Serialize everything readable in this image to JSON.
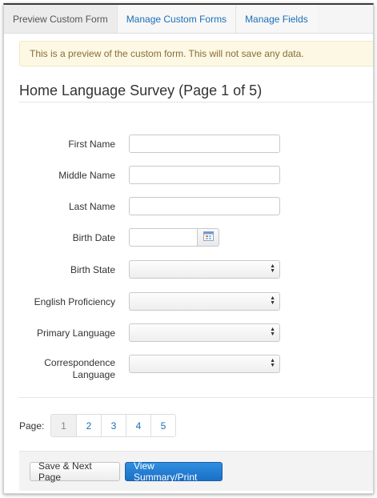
{
  "tabs": [
    {
      "label": "Preview Custom Form",
      "active": true
    },
    {
      "label": "Manage Custom Forms",
      "active": false
    },
    {
      "label": "Manage Fields",
      "active": false
    }
  ],
  "alert": {
    "text": "This is a preview of the custom form. This will not save any data."
  },
  "form": {
    "title": "Home Language Survey (Page 1 of 5)",
    "fields": {
      "first_name": {
        "label": "First Name",
        "value": ""
      },
      "middle_name": {
        "label": "Middle Name",
        "value": ""
      },
      "last_name": {
        "label": "Last Name",
        "value": ""
      },
      "birth_date": {
        "label": "Birth Date",
        "value": "",
        "icon": "calendar-icon"
      },
      "birth_state": {
        "label": "Birth State",
        "selected": ""
      },
      "english_proficiency": {
        "label": "English Proficiency",
        "selected": ""
      },
      "primary_language": {
        "label": "Primary Language",
        "selected": ""
      },
      "correspondence_language": {
        "label_line1": "Correspondence",
        "label_line2": "Language",
        "selected": ""
      }
    }
  },
  "pagination": {
    "label": "Page:",
    "pages": [
      "1",
      "2",
      "3",
      "4",
      "5"
    ],
    "current": "1"
  },
  "buttons": {
    "save_next": "Save & Next Page",
    "view_summary": "View Summary/Print"
  },
  "colors": {
    "link": "#1a6fb8",
    "alert_bg": "#fcf8e3",
    "alert_text": "#8a6d3b",
    "primary_button": "#1b6fc6"
  }
}
